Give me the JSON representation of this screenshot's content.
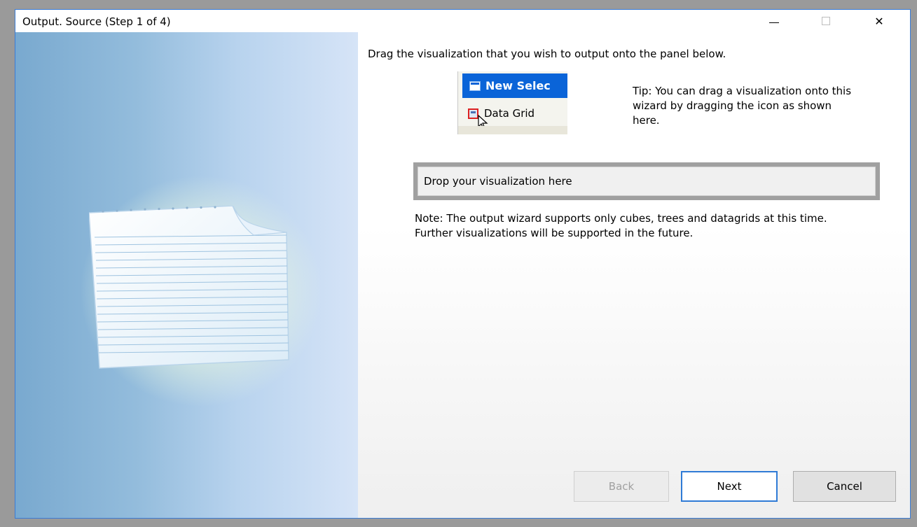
{
  "window": {
    "title": "Output.  Source (Step 1 of 4)",
    "controls": {
      "minimize_icon": "minimize-icon",
      "maximize_icon": "maximize-icon",
      "close_icon": "close-icon",
      "close_glyph": "✕"
    }
  },
  "sidebar": {
    "illustration": "document-icon"
  },
  "content": {
    "instruction": "Drag the visualization that you wish to output onto the panel below.",
    "tip_image": {
      "header_label": "New Selec",
      "item_label": "Data Grid"
    },
    "tip_text": "Tip: You can drag a visualization onto this wizard by dragging the icon as shown here.",
    "drop_zone_label": "Drop your visualization here",
    "note": "Note: The output wizard supports only cubes, trees and datagrids at this time.  Further visualizations will be supported in the future."
  },
  "buttons": {
    "back": {
      "label": "Back",
      "enabled": false
    },
    "next": {
      "label": "Next",
      "enabled": true,
      "default": true
    },
    "cancel": {
      "label": "Cancel",
      "enabled": true
    }
  },
  "colors": {
    "accent": "#2f7bd6",
    "tip_header": "#0a64d8",
    "drop_border": "#a0a0a0"
  }
}
